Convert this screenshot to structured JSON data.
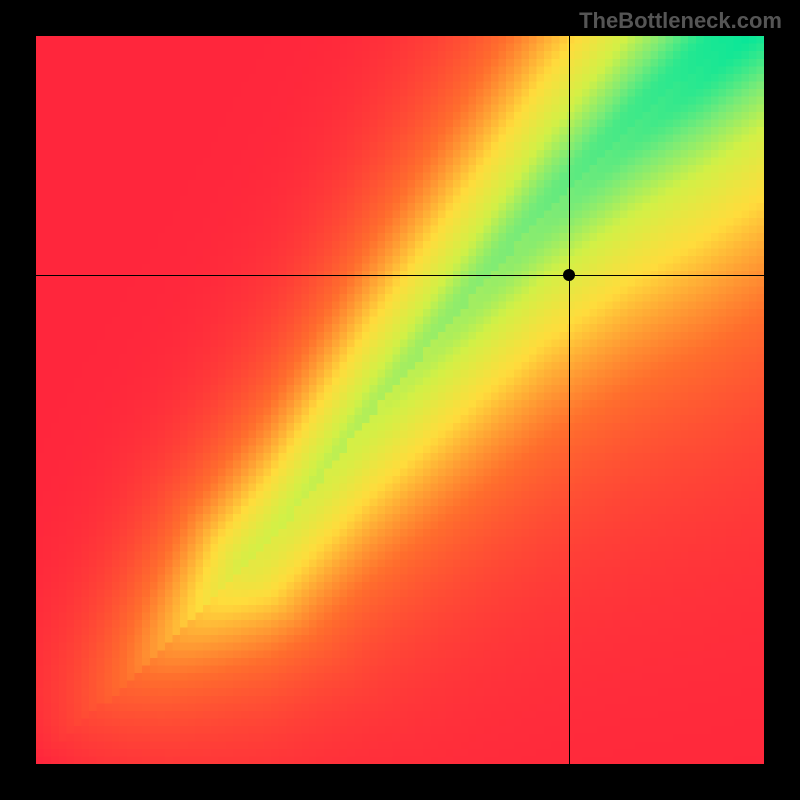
{
  "watermark": "TheBottleneck.com",
  "chart_data": {
    "type": "heatmap",
    "title": "",
    "xlabel": "",
    "ylabel": "",
    "xlim": [
      0,
      100
    ],
    "ylim": [
      0,
      100
    ],
    "grid_resolution": [
      96,
      96
    ],
    "crosshair": {
      "x": 73.2,
      "y": 67.2
    },
    "marker": {
      "x": 73.2,
      "y": 67.2
    },
    "colorscale_note": "red=0 orange=0.25 yellow=0.5 yellowgreen=0.75 green=1",
    "green_ridge_control_points": [
      {
        "x": 0,
        "y": 0
      },
      {
        "x": 18,
        "y": 16
      },
      {
        "x": 32,
        "y": 30
      },
      {
        "x": 46,
        "y": 48
      },
      {
        "x": 58,
        "y": 62
      },
      {
        "x": 70,
        "y": 76
      },
      {
        "x": 82,
        "y": 88
      },
      {
        "x": 92,
        "y": 97
      },
      {
        "x": 100,
        "y": 105
      }
    ],
    "green_ridge_width_pct_at": {
      "bottom": 1.0,
      "mid": 6.0,
      "top": 11.0
    }
  }
}
